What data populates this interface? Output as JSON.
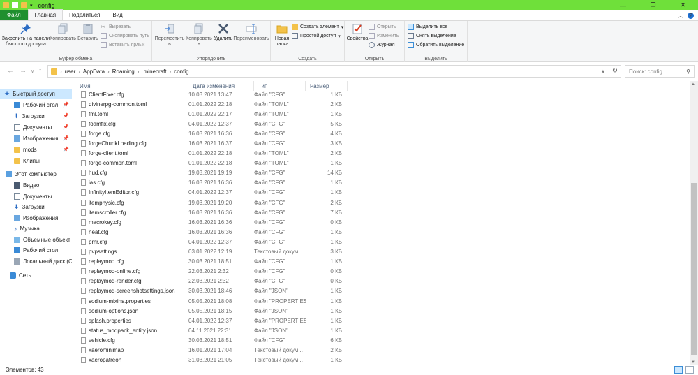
{
  "window": {
    "title": "config"
  },
  "tabs": [
    "Файл",
    "Главная",
    "Поделиться",
    "Вид"
  ],
  "ribbon": {
    "clipboard": {
      "label": "Буфер обмена",
      "pin": "Закрепить на панели быстрого доступа",
      "copy": "Копировать",
      "paste": "Вставить",
      "cut": "Вырезать",
      "copy_path": "Скопировать путь",
      "paste_shortcut": "Вставить ярлык"
    },
    "organize": {
      "label": "Упорядочить",
      "move": "Переместить в",
      "copy_to": "Копировать в",
      "delete": "Удалить",
      "rename": "Переименовать"
    },
    "new": {
      "label": "Создать",
      "new_folder": "Новая папка",
      "new_item": "Создать элемент",
      "easy_access": "Простой доступ"
    },
    "open": {
      "label": "Открыть",
      "properties": "Свойства",
      "open": "Открыть",
      "edit": "Изменить",
      "history": "Журнал"
    },
    "select": {
      "label": "Выделить",
      "select_all": "Выделить все",
      "select_none": "Снять выделение",
      "invert": "Обратить выделение"
    }
  },
  "address": {
    "crumbs": [
      "user",
      "AppData",
      "Roaming",
      ".minecraft",
      "config"
    ],
    "search_placeholder": "Поиск: config"
  },
  "nav": {
    "quick_access": "Быстрый доступ",
    "quick_items": [
      "Рабочий стол",
      "Загрузки",
      "Документы",
      "Изображения",
      "mods",
      "Клипы"
    ],
    "this_pc": "Этот компьютер",
    "pc_items": [
      "Видео",
      "Документы",
      "Загрузки",
      "Изображения",
      "Музыка",
      "Объемные объект",
      "Рабочий стол",
      "Локальный диск (C"
    ],
    "network": "Сеть"
  },
  "columns": {
    "name": "Имя",
    "date": "Дата изменения",
    "type": "Тип",
    "size": "Размер"
  },
  "files": [
    {
      "name": "ClientFixer.cfg",
      "date": "10.03.2021 13:47",
      "type": "Файл \"CFG\"",
      "size": "1 КБ"
    },
    {
      "name": "divinerpg-common.toml",
      "date": "01.01.2022 22:18",
      "type": "Файл \"TOML\"",
      "size": "2 КБ"
    },
    {
      "name": "fml.toml",
      "date": "01.01.2022 22:17",
      "type": "Файл \"TOML\"",
      "size": "1 КБ"
    },
    {
      "name": "foamfix.cfg",
      "date": "04.01.2022 12:37",
      "type": "Файл \"CFG\"",
      "size": "5 КБ"
    },
    {
      "name": "forge.cfg",
      "date": "16.03.2021 16:36",
      "type": "Файл \"CFG\"",
      "size": "4 КБ"
    },
    {
      "name": "forgeChunkLoading.cfg",
      "date": "16.03.2021 16:37",
      "type": "Файл \"CFG\"",
      "size": "3 КБ"
    },
    {
      "name": "forge-client.toml",
      "date": "01.01.2022 22:18",
      "type": "Файл \"TOML\"",
      "size": "2 КБ"
    },
    {
      "name": "forge-common.toml",
      "date": "01.01.2022 22:18",
      "type": "Файл \"TOML\"",
      "size": "1 КБ"
    },
    {
      "name": "hud.cfg",
      "date": "19.03.2021 19:19",
      "type": "Файл \"CFG\"",
      "size": "14 КБ"
    },
    {
      "name": "ias.cfg",
      "date": "16.03.2021 16:36",
      "type": "Файл \"CFG\"",
      "size": "1 КБ"
    },
    {
      "name": "InfinityItemEditor.cfg",
      "date": "04.01.2022 12:37",
      "type": "Файл \"CFG\"",
      "size": "1 КБ"
    },
    {
      "name": "itemphysic.cfg",
      "date": "19.03.2021 19:20",
      "type": "Файл \"CFG\"",
      "size": "2 КБ"
    },
    {
      "name": "itemscroller.cfg",
      "date": "16.03.2021 16:36",
      "type": "Файл \"CFG\"",
      "size": "7 КБ"
    },
    {
      "name": "macrokey.cfg",
      "date": "16.03.2021 16:36",
      "type": "Файл \"CFG\"",
      "size": "0 КБ"
    },
    {
      "name": "neat.cfg",
      "date": "16.03.2021 16:36",
      "type": "Файл \"CFG\"",
      "size": "1 КБ"
    },
    {
      "name": "pmr.cfg",
      "date": "04.01.2022 12:37",
      "type": "Файл \"CFG\"",
      "size": "1 КБ"
    },
    {
      "name": "pvpsettings",
      "date": "03.01.2022 12:19",
      "type": "Текстовый докум...",
      "size": "3 КБ"
    },
    {
      "name": "replaymod.cfg",
      "date": "30.03.2021 18:51",
      "type": "Файл \"CFG\"",
      "size": "1 КБ"
    },
    {
      "name": "replaymod-online.cfg",
      "date": "22.03.2021 2:32",
      "type": "Файл \"CFG\"",
      "size": "0 КБ"
    },
    {
      "name": "replaymod-render.cfg",
      "date": "22.03.2021 2:32",
      "type": "Файл \"CFG\"",
      "size": "0 КБ"
    },
    {
      "name": "replaymod-screenshotsettings.json",
      "date": "30.03.2021 18:46",
      "type": "Файл \"JSON\"",
      "size": "1 КБ"
    },
    {
      "name": "sodium-mixins.properties",
      "date": "05.05.2021 18:08",
      "type": "Файл \"PROPERTIES\"",
      "size": "1 КБ"
    },
    {
      "name": "sodium-options.json",
      "date": "05.05.2021 18:15",
      "type": "Файл \"JSON\"",
      "size": "1 КБ"
    },
    {
      "name": "splash.properties",
      "date": "04.01.2022 12:37",
      "type": "Файл \"PROPERTIES\"",
      "size": "1 КБ"
    },
    {
      "name": "status_modpack_entity.json",
      "date": "04.11.2021 22:31",
      "type": "Файл \"JSON\"",
      "size": "1 КБ"
    },
    {
      "name": "vehicle.cfg",
      "date": "30.03.2021 18:51",
      "type": "Файл \"CFG\"",
      "size": "6 КБ"
    },
    {
      "name": "xaerominimap",
      "date": "16.01.2021 17:04",
      "type": "Текстовый докум...",
      "size": "2 КБ"
    },
    {
      "name": "xaeropatreon",
      "date": "31.03.2021 21:05",
      "type": "Текстовый докум...",
      "size": "1 КБ"
    }
  ],
  "status": {
    "count": "Элементов: 43"
  },
  "colors": {
    "titlebar": "#6fe03a",
    "file_tab": "#1f8f2f",
    "accent": "#1e6fd0",
    "selection": "#cce8ff"
  }
}
